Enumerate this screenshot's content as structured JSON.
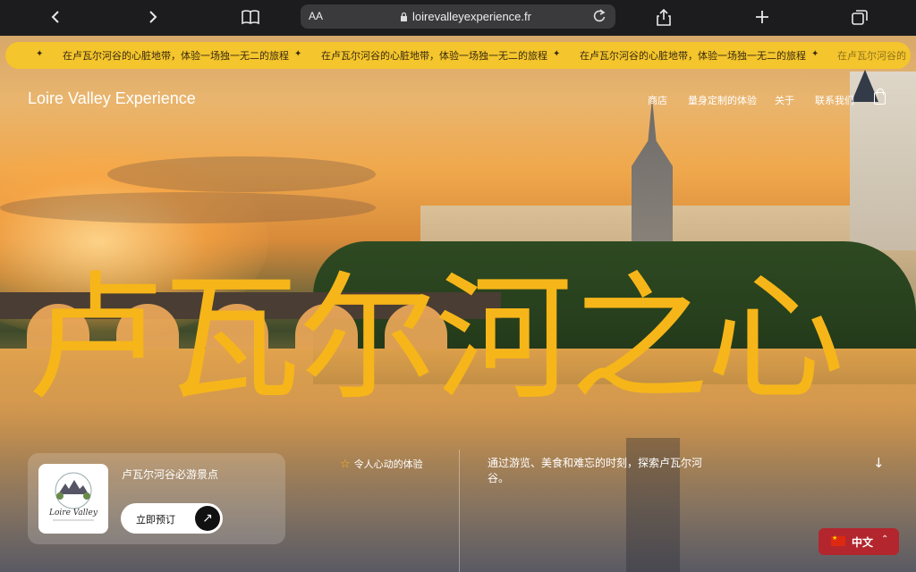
{
  "browser": {
    "text_size_label": "AA",
    "url": "loirevalleyexperience.fr"
  },
  "ticker": {
    "text": "在卢瓦尔河谷的心脏地带，体验一场独一无二的旅程",
    "partial_text": "在卢瓦尔河谷的",
    "separator_icon": "sparkle-icon"
  },
  "header": {
    "brand": "Loire Valley Experience",
    "nav": [
      "商店",
      "量身定制的体验",
      "关于",
      "联系我们"
    ],
    "cart_icon": "shopping-bag-icon"
  },
  "hero": {
    "headline": "卢瓦尔河之心",
    "headline_color": "#f6b619"
  },
  "card": {
    "logo_text": "Loire Valley",
    "title": "卢瓦尔河谷必游景点",
    "button_label": "立即预订"
  },
  "tag": "令人心动的体验",
  "description": "通过游览、美食和难忘的时刻，探索卢瓦尔河谷。",
  "language": {
    "label": "中文",
    "flag": "china-flag-icon"
  },
  "colors": {
    "accent": "#f4c52c",
    "lang_button": "#b3262e"
  }
}
